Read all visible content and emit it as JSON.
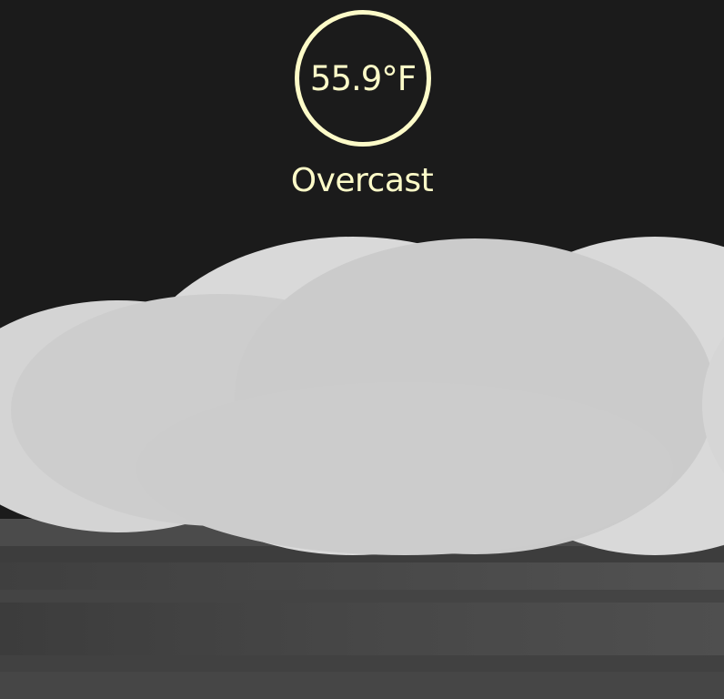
{
  "weather": {
    "temperature": "55.9°F",
    "condition": "Overcast"
  },
  "colors": {
    "background": "#1b1b1b",
    "accent": "#fdfbc8",
    "cloud_light": "#d9d9d9",
    "cloud_mid": "#cdcdcd",
    "ground_dark": "#3a3a3a",
    "ground_light": "#4e4e4e"
  }
}
